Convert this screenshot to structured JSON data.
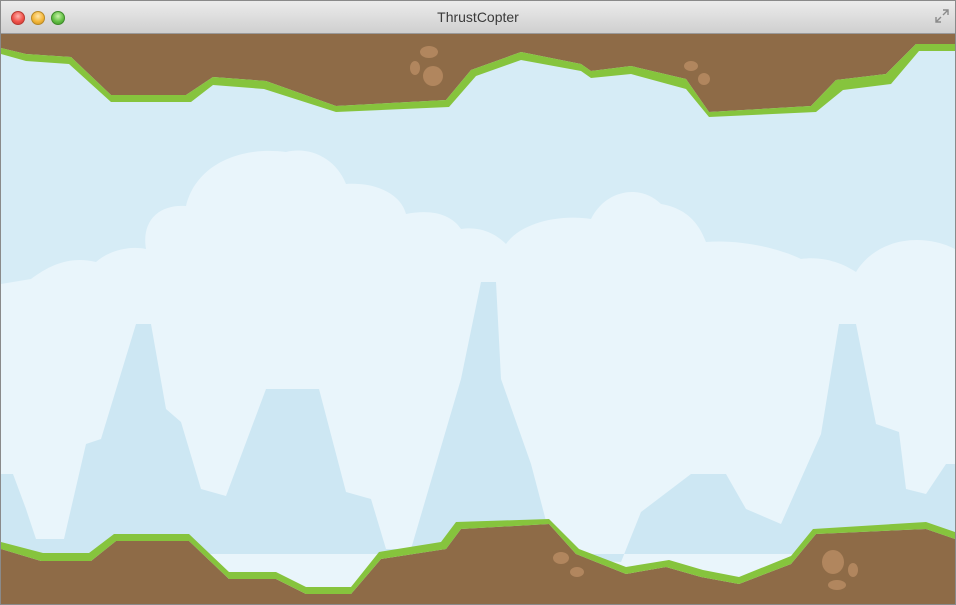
{
  "window": {
    "title": "ThrustCopter",
    "controls": [
      "close",
      "minimize",
      "zoom"
    ]
  },
  "scene": {
    "sky_color": "#d6ecf6",
    "cloud_color": "#e9f5fb",
    "mountain_color": "#cde7f3",
    "ground_color": "#8e6b47",
    "grass_color": "#86c43d",
    "grass_dark_color": "#5e9e2a",
    "rock_color": "#b1865e"
  }
}
